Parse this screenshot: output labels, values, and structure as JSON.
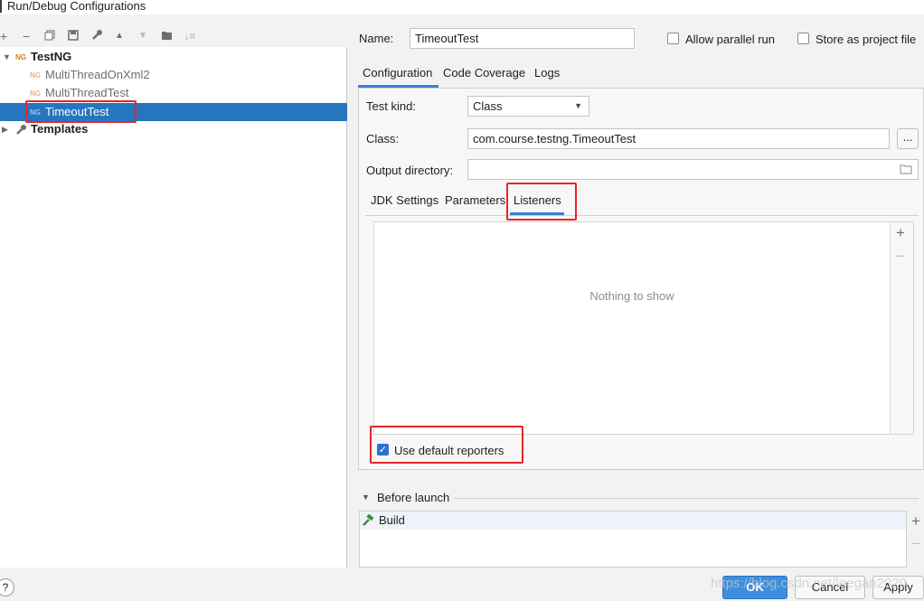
{
  "window": {
    "title": "Run/Debug Configurations"
  },
  "toolbar": {
    "icons": [
      "add-icon",
      "remove-icon",
      "copy-icon",
      "save-icon",
      "wrench-icon",
      "move-up-icon",
      "move-down-icon",
      "new-folder-icon",
      "sort-icon"
    ]
  },
  "tree": {
    "root_label": "TestNG",
    "items": [
      {
        "label": "MultiThreadOnXml2"
      },
      {
        "label": "MultiThreadTest"
      },
      {
        "label": "TimeoutTest"
      }
    ],
    "templates_label": "Templates"
  },
  "config": {
    "name_label": "Name:",
    "name_value": "TimeoutTest",
    "allow_parallel_label": "Allow parallel run",
    "store_project_label": "Store as project file",
    "tabs": [
      "Configuration",
      "Code Coverage",
      "Logs"
    ],
    "test_kind_label": "Test kind:",
    "test_kind_value": "Class",
    "class_label": "Class:",
    "class_value": "com.course.testng.TimeoutTest",
    "class_browse": "...",
    "output_dir_label": "Output directory:",
    "output_dir_value": "",
    "subtabs": [
      "JDK Settings",
      "Parameters",
      "Listeners"
    ],
    "listeners_empty": "Nothing to show",
    "use_default_reporters_label": "Use default reporters",
    "use_default_reporters_checked": true
  },
  "before_launch": {
    "label": "Before launch",
    "items": [
      {
        "label": "Build"
      }
    ]
  },
  "footer": {
    "help": "?",
    "ok": "OK",
    "cancel": "Cancel",
    "apply": "Apply",
    "watermark": "https://blog.csdn.net/leegan2020"
  },
  "colors": {
    "selection": "#2675bf",
    "highlight_box": "#e4262a",
    "tab_underline": "#3b7dd8",
    "ok_button": "#3d8ee0"
  }
}
